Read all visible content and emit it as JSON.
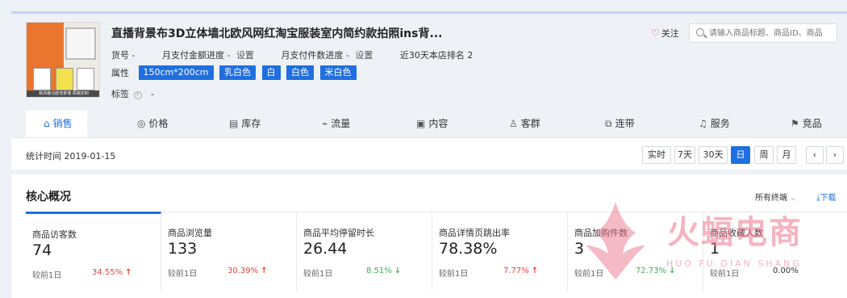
{
  "product": {
    "title": "直播背景布3D立体墙北欧风网红淘宝服装室内简约款拍照ins背...",
    "image_caption": "新风格北欧背景墙 高端定制",
    "sku_label": "货号 -",
    "pay_amount_label": "月支付金额进度 -",
    "pay_amount_set": "设置",
    "pay_count_label": "月支付件数进度 -",
    "pay_count_set": "设置",
    "rank_text": "近30天本店排名 2",
    "attr_label": "属性",
    "attrs": [
      "150cm*200cm",
      "乳白色",
      "白",
      "白色",
      "米白色"
    ],
    "tag_label": "标签",
    "tag_value": "-"
  },
  "header": {
    "follow_label": "关注",
    "search_placeholder": "请输入商品标题、商品ID、商品"
  },
  "tabs": [
    {
      "label": "销售",
      "icon": "home-icon"
    },
    {
      "label": "价格",
      "icon": "price-icon"
    },
    {
      "label": "库存",
      "icon": "inventory-icon"
    },
    {
      "label": "流量",
      "icon": "traffic-chart-icon"
    },
    {
      "label": "内容",
      "icon": "content-icon"
    },
    {
      "label": "客群",
      "icon": "users-icon"
    },
    {
      "label": "连带",
      "icon": "link-icon"
    },
    {
      "label": "服务",
      "icon": "headset-icon"
    },
    {
      "label": "竞品",
      "icon": "competitor-icon"
    }
  ],
  "datebar": {
    "stat_time": "统计时间 2019-01-15",
    "buttons": [
      "实时",
      "7天",
      "30天",
      "日",
      "周",
      "月"
    ],
    "prev": "‹",
    "next": "›",
    "active_period": "日"
  },
  "core": {
    "title": "核心概况",
    "terminals_label": "所有终端",
    "download_label": "下载",
    "compare_label": "较前1日",
    "metrics": [
      {
        "name": "商品访客数",
        "value": "74",
        "change": "34.55%",
        "trend": "up"
      },
      {
        "name": "商品浏览量",
        "value": "133",
        "change": "30.39%",
        "trend": "up"
      },
      {
        "name": "商品平均停留时长",
        "value": "26.44",
        "change": "8.51%",
        "trend": "down"
      },
      {
        "name": "商品详情页跳出率",
        "value": "78.38%",
        "change": "7.77%",
        "trend": "up"
      },
      {
        "name": "商品加购件数",
        "value": "3",
        "change": "72.73%",
        "trend": "down"
      },
      {
        "name": "商品收藏人数",
        "value": "1",
        "change": "0.00%",
        "trend": "flat"
      }
    ]
  },
  "watermark": {
    "text": "火蝠电商",
    "subtext": "HUO FU DIAN SHANG"
  },
  "colors": {
    "accent": "#1f6fe0",
    "up": "#e0443e",
    "down": "#3cae5e",
    "watermark": "#ee748e"
  }
}
